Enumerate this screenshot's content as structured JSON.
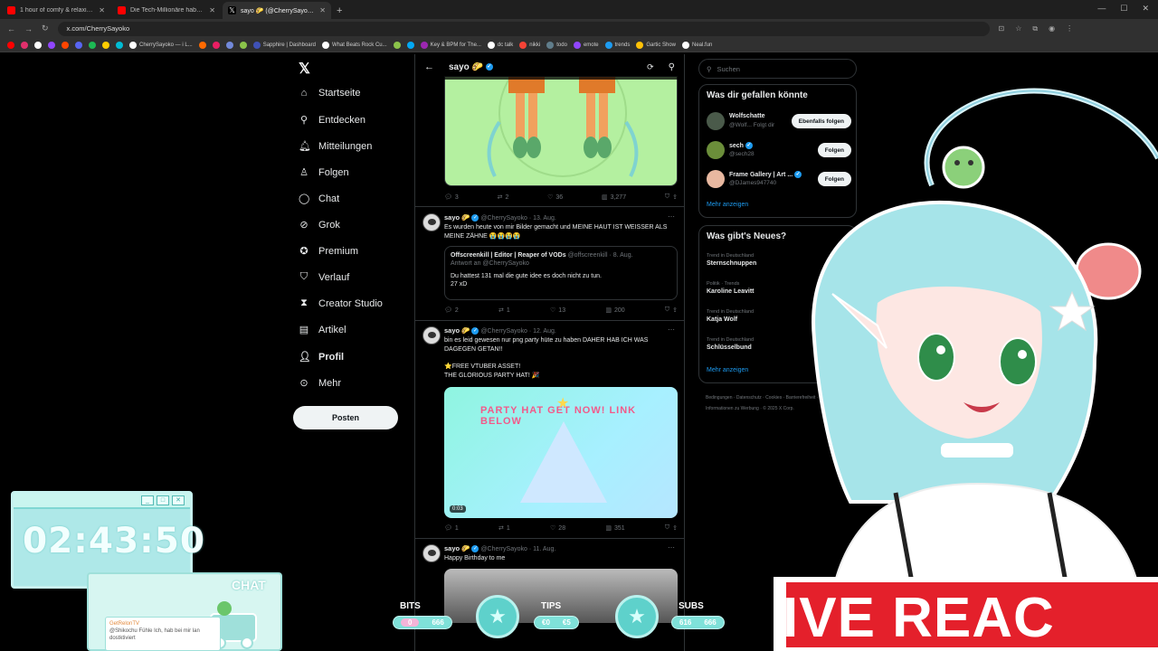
{
  "browser": {
    "tabs": [
      {
        "title": "1 hour of comfy & relaxing son",
        "color": "#ff0000"
      },
      {
        "title": "Die Tech-Millionäre haben sich",
        "color": "#ff0000"
      },
      {
        "title": "sayo 🌮 (@CherrySayoko) / X",
        "color": "#000000",
        "active": true
      }
    ],
    "new_tab": "+",
    "url": "x.com/CherrySayoko",
    "bookmarks": [
      "CherrySayoko — i L...",
      "Sapphire | Dashboard",
      "What Beats Rock Cu...",
      "Key & BPM for The...",
      "dc talk",
      "nikki",
      "todo",
      "emote",
      "trends",
      "Gartic Show",
      "Neal.fun"
    ]
  },
  "nav": {
    "items": [
      {
        "label": "Startseite",
        "icon": "home-icon"
      },
      {
        "label": "Entdecken",
        "icon": "search-icon"
      },
      {
        "label": "Mitteilungen",
        "icon": "bell-icon"
      },
      {
        "label": "Folgen",
        "icon": "follow-icon"
      },
      {
        "label": "Chat",
        "icon": "chat-icon"
      },
      {
        "label": "Grok",
        "icon": "grok-icon"
      },
      {
        "label": "Premium",
        "icon": "premium-icon"
      },
      {
        "label": "Verlauf",
        "icon": "bookmark-icon"
      },
      {
        "label": "Creator Studio",
        "icon": "studio-icon"
      },
      {
        "label": "Artikel",
        "icon": "article-icon"
      },
      {
        "label": "Profil",
        "icon": "profile-icon"
      },
      {
        "label": "Mehr",
        "icon": "more-icon"
      }
    ],
    "post_label": "Posten"
  },
  "feed": {
    "header_name": "sayo 🌮",
    "tweet0_actions": {
      "replies": "3",
      "reposts": "2",
      "likes": "36",
      "views": "3,277"
    },
    "tweet1": {
      "name": "sayo 🌮",
      "handle": "@CherrySayoko · 13. Aug.",
      "text": "Es wurden heute von mir Bilder gemacht und MEINE HAUT IST WEISSER ALS MEINE ZÄHNE 😭😭😭😭",
      "quote_name": "Offscreenkill | Editor | Reaper of VODs",
      "quote_handle": "@offscreenkill · 8. Aug.",
      "quote_reply": "Antwort an @CherrySayoko",
      "quote_text": "Du hattest 131 mal die gute idee es doch nicht zu tun.\n27 xD",
      "actions": {
        "replies": "2",
        "reposts": "1",
        "likes": "13",
        "views": "200"
      }
    },
    "tweet2": {
      "name": "sayo 🌮",
      "handle": "@CherrySayoko · 12. Aug.",
      "text": "bin es leid gewesen nur png party hüte zu haben  DAHER HAB ICH WAS DAGEGEN GETAN!!",
      "text2": "⭐FREE VTUBER ASSET!\nTHE GLORIOUS PARTY HAT! 🎉",
      "media_text": "PARTY HAT GET NOW! LINK BELOW",
      "duration": "0:03",
      "actions": {
        "replies": "1",
        "reposts": "1",
        "likes": "28",
        "views": "351"
      }
    },
    "tweet3": {
      "name": "sayo 🌮",
      "handle": "@CherrySayoko · 11. Aug.",
      "text": "Happy Birthday to me"
    }
  },
  "right": {
    "search_placeholder": "Suchen",
    "suggest_title": "Was dir gefallen könnte",
    "suggestions": [
      {
        "name": "Wolfschatte",
        "handle": "@Wolf... Folgt dir",
        "button": "Ebenfalls folgen",
        "color": "#4a5a4a"
      },
      {
        "name": "sech",
        "handle": "@sech28",
        "button": "Folgen",
        "color": "#6b8e3a"
      },
      {
        "name": "Frame Gallery | Art ...",
        "handle": "@DJames947740",
        "button": "Folgen",
        "color": "#e8b8a0"
      }
    ],
    "show_more": "Mehr anzeigen",
    "trends_title": "Was gibt's Neues?",
    "trends": [
      {
        "context": "Trend in Deutschland",
        "name": "Sternschnuppen"
      },
      {
        "context": "Politik · Trends",
        "name": "Karoline Leavitt"
      },
      {
        "context": "Trend in Deutschland",
        "name": "Katja Wolf"
      },
      {
        "context": "Trend in Deutschland",
        "name": "Schlüsselbund"
      }
    ],
    "trends_more": "Mehr anzeigen",
    "footer": "Bedingungen · Datenschutz · Cookies · Barrierefreiheit · Informationen zu Werbung · © 2025 X Corp."
  },
  "overlay": {
    "timer": "02:43:50",
    "chat_title": "CHAT",
    "chat_user": "GetRelonTV",
    "chat_text": "@Shikochu Fühle Ich, hab bei mir lan dostktiviert",
    "bits_label": "BITS",
    "bits_values": [
      "0",
      "666"
    ],
    "tips_label": "TIPS",
    "tips_values": [
      "€0",
      "€5"
    ],
    "subs_label": "SUBS",
    "subs_values": [
      "616",
      "666"
    ],
    "banner_text": "IVE REAC"
  }
}
